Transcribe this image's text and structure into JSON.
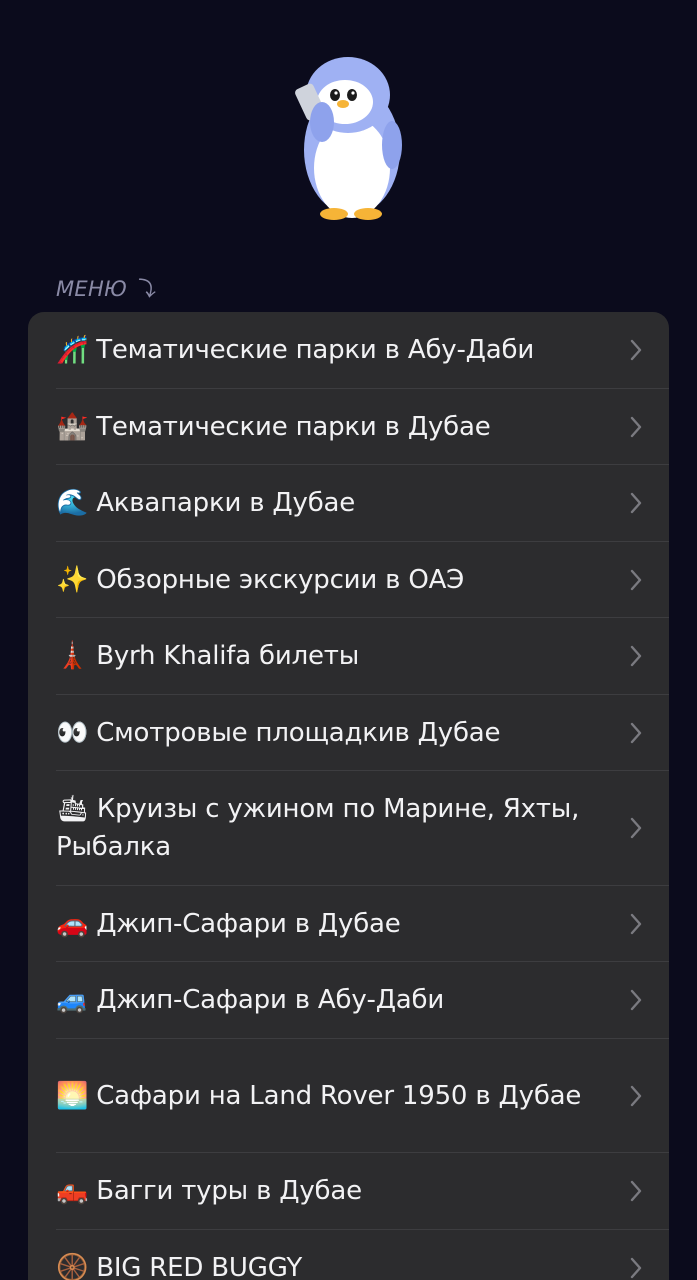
{
  "section_label": "МЕНЮ ⤵",
  "menu": [
    {
      "emoji": "🎢",
      "label": "Тематические парки в Абу-Даби",
      "name": "menu-item-abu-dhabi-theme-parks"
    },
    {
      "emoji": "🏰",
      "label": "Тематические парки в Дубае",
      "name": "menu-item-dubai-theme-parks"
    },
    {
      "emoji": "🌊",
      "label": "Аквапарки в Дубае",
      "name": "menu-item-dubai-waterparks"
    },
    {
      "emoji": "✨",
      "label": "Обзорные экскурсии в ОАЭ",
      "name": "menu-item-uae-tours"
    },
    {
      "emoji": "🗼",
      "label": "Byrh Khalifa билеты",
      "name": "menu-item-burj-khalifa-tickets"
    },
    {
      "emoji": "👀",
      "label": "Смотровые площадкив Дубае",
      "name": "menu-item-observation-decks"
    },
    {
      "emoji": "🛳",
      "label": "Круизы с ужином по Марине, Яхты, Рыбалка",
      "name": "menu-item-cruises"
    },
    {
      "emoji": "🚗",
      "label": "Джип-Сафари в Дубае",
      "name": "menu-item-jeep-safari-dubai"
    },
    {
      "emoji": "🚙",
      "label": "Джип-Сафари в Абу-Даби",
      "name": "menu-item-jeep-safari-abu-dhabi"
    },
    {
      "emoji": "🌅",
      "label": "Сафари на Land Rover 1950 в Дубае",
      "name": "menu-item-land-rover-safari"
    },
    {
      "emoji": "🛻",
      "label": "Багги туры в Дубае",
      "name": "menu-item-buggy-tours"
    },
    {
      "emoji": "🛞",
      "label": "BIG RED BUGGY",
      "name": "menu-item-big-red-buggy"
    }
  ]
}
